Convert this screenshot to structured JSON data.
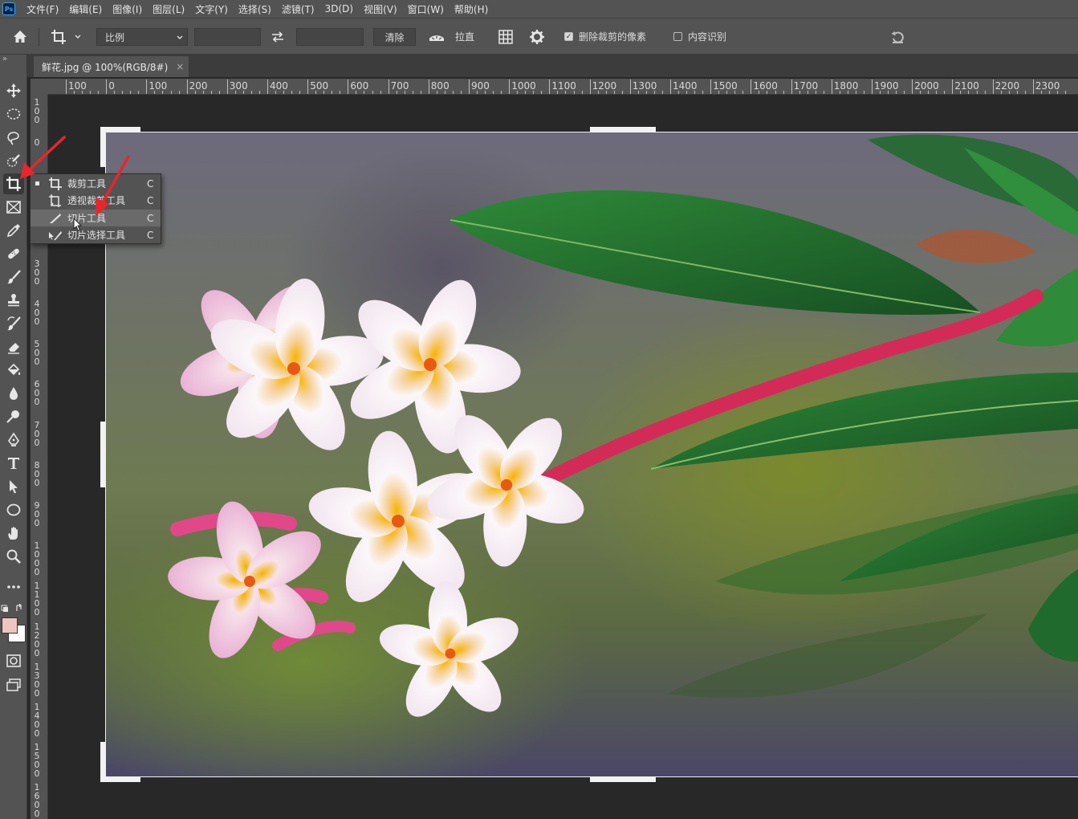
{
  "app": {
    "logo_text": "Ps"
  },
  "menu": [
    "文件(F)",
    "编辑(E)",
    "图像(I)",
    "图层(L)",
    "文字(Y)",
    "选择(S)",
    "滤镜(T)",
    "3D(D)",
    "视图(V)",
    "窗口(W)",
    "帮助(H)"
  ],
  "options": {
    "ratio_select": "比例",
    "width_value": "",
    "height_value": "",
    "clear_button": "清除",
    "straighten_label": "拉直",
    "delete_cropped_label": "删除裁剪的像素",
    "delete_cropped_checked": true,
    "content_aware_label": "内容识别",
    "content_aware_checked": false
  },
  "document": {
    "tab_title": "鲜花.jpg @ 100%(RGB/8#)",
    "close_glyph": "×"
  },
  "ruler_h_labels": [
    "100",
    "0",
    "100",
    "200",
    "300",
    "400",
    "500",
    "600",
    "700",
    "800",
    "900",
    "1000",
    "1100",
    "1200",
    "1300",
    "1400",
    "1500",
    "1600",
    "1700",
    "1800",
    "1900",
    "2000",
    "2100",
    "2200",
    "2300"
  ],
  "ruler_v_labels": [
    "100",
    "0",
    "",
    "",
    "300",
    "400",
    "500",
    "600",
    "700",
    "800",
    "900",
    "1000",
    "1100",
    "1200",
    "1300",
    "1400",
    "1500",
    "1600"
  ],
  "flyout": [
    {
      "label": "裁剪工具",
      "key": "C",
      "icon": "crop-icon",
      "active": true
    },
    {
      "label": "透视裁剪工具",
      "key": "C",
      "icon": "perspective-crop-icon",
      "active": false
    },
    {
      "label": "切片工具",
      "key": "C",
      "icon": "slice-icon",
      "active": false
    },
    {
      "label": "切片选择工具",
      "key": "C",
      "icon": "slice-select-icon",
      "active": false
    }
  ],
  "colors": {
    "foreground": "#f0c4c0",
    "background": "#ffffff",
    "arrow": "#e8262b"
  }
}
